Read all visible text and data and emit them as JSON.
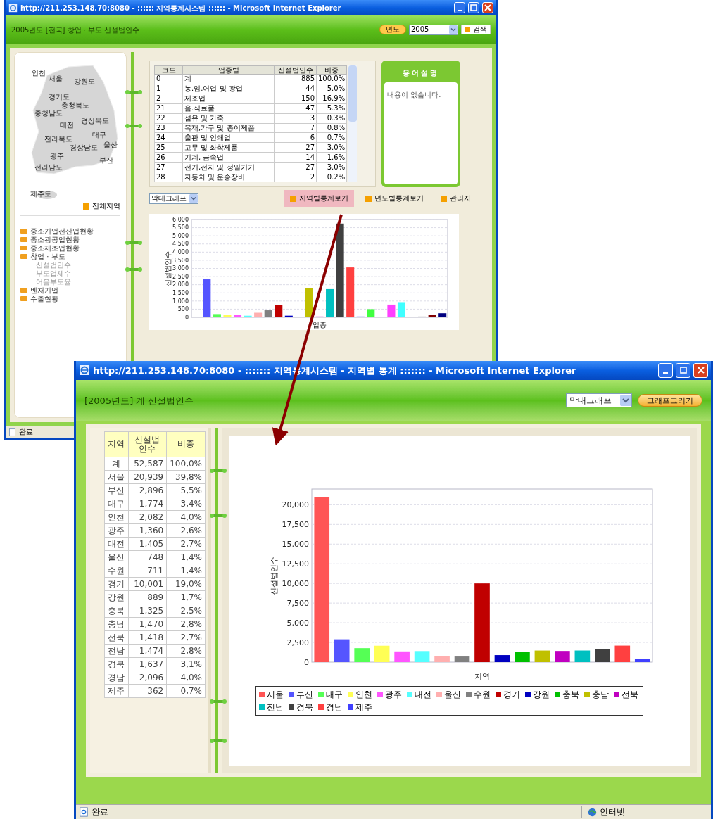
{
  "back_window": {
    "title": "http://211.253.148.70:8080 - :::::: 지역통계시스템 :::::: - Microsoft Internet Explorer",
    "header": "2005년도 [전국] 창업 · 부도 신설법인수",
    "year_button": "년도",
    "year_select": "2005",
    "search_button": "검색",
    "map_labels": [
      "인천",
      "서울",
      "강원도",
      "경기도",
      "충청북도",
      "충청남도",
      "경상북도",
      "대전",
      "대구",
      "전라북도",
      "경상남도",
      "울산",
      "광주",
      "부산",
      "전라남도",
      "제주도"
    ],
    "all_regions_button": "전체지역",
    "menu": [
      {
        "label": "중소기업전산업현황",
        "kind": "folder"
      },
      {
        "label": "중소광공업현황",
        "kind": "folder"
      },
      {
        "label": "중소제조업현황",
        "kind": "folder"
      },
      {
        "label": "창업 · 부도",
        "kind": "folder"
      },
      {
        "label": "신설법인수",
        "kind": "sub"
      },
      {
        "label": "부도업체수",
        "kind": "sub"
      },
      {
        "label": "어음부도율",
        "kind": "sub"
      },
      {
        "label": "벤처기업",
        "kind": "folder"
      },
      {
        "label": "수출현황",
        "kind": "folder"
      }
    ],
    "table": {
      "columns": [
        "코드",
        "업종별",
        "신설법인수",
        "비중"
      ],
      "rows": [
        [
          "0",
          "계",
          "885",
          "100.0%"
        ],
        [
          "1",
          "농.임.어업 및 광업",
          "44",
          "5.0%"
        ],
        [
          "2",
          "제조업",
          "150",
          "16.9%"
        ],
        [
          "21",
          "음.식료품",
          "47",
          "5.3%"
        ],
        [
          "22",
          "섬유 및 가죽",
          "3",
          "0.3%"
        ],
        [
          "23",
          "목재,가구 및 종이제품",
          "7",
          "0.8%"
        ],
        [
          "24",
          "출판 및 인쇄업",
          "6",
          "0.7%"
        ],
        [
          "25",
          "고무 및 화학제품",
          "27",
          "3.0%"
        ],
        [
          "26",
          "기계, 금속업",
          "14",
          "1.6%"
        ],
        [
          "27",
          "전기,전자 및 정밀기기",
          "27",
          "3.0%"
        ],
        [
          "28",
          "자동차 및 운송장비",
          "2",
          "0.2%"
        ]
      ]
    },
    "term_panel": {
      "title": "용어설명",
      "text": "내용이 없습니다."
    },
    "chart_type_select": "막대그래프",
    "actions": [
      {
        "label": "지역별통계보기",
        "highlighted": true
      },
      {
        "label": "년도별통계보기",
        "highlighted": false
      },
      {
        "label": "관리자",
        "highlighted": false
      }
    ],
    "chart": {
      "chart_data": {
        "type": "bar",
        "xlabel": "업종",
        "ylabel": "신설법인수",
        "grid": true,
        "values": [
          null,
          2330,
          200,
          150,
          130,
          100,
          280,
          430,
          750,
          100,
          null,
          1800,
          50,
          1730,
          5750,
          3060,
          50,
          500,
          null,
          780,
          930,
          null,
          50,
          130,
          250
        ],
        "ylim": [
          0,
          6000
        ],
        "yticks": [
          {
            "value": 0,
            "label": "0"
          },
          {
            "value": 500,
            "label": "500"
          },
          {
            "value": 1000,
            "label": "1,000"
          },
          {
            "value": 1500,
            "label": "1,500"
          },
          {
            "value": 2000,
            "label": "2,000"
          },
          {
            "value": 2500,
            "label": "2,500"
          },
          {
            "value": 3000,
            "label": "3,000"
          },
          {
            "value": 3500,
            "label": "3,500"
          },
          {
            "value": 4000,
            "label": "4,000"
          },
          {
            "value": 4500,
            "label": "4,500"
          },
          {
            "value": 5000,
            "label": "5,000"
          },
          {
            "value": 5500,
            "label": "5,500"
          },
          {
            "value": 6000,
            "label": "6,000"
          }
        ]
      },
      "bars": [
        {
          "color": "#5555ff"
        },
        {
          "color": "#55ff55"
        },
        {
          "color": "#ffff55"
        },
        {
          "color": "#ff55ff"
        },
        {
          "color": "#55ffff"
        },
        {
          "color": "#ffafaf"
        },
        {
          "color": "#808080"
        },
        {
          "color": "#c00000"
        },
        {
          "color": "#0000c0"
        },
        {
          "color": "#c0c000"
        },
        {
          "color": "#c000c0"
        },
        {
          "color": "#00c0c0"
        },
        {
          "color": "#404040"
        },
        {
          "color": "#ff4040"
        },
        {
          "color": "#4040ff"
        },
        {
          "color": "#40ff40"
        },
        {
          "color": "#ff40ff"
        },
        {
          "color": "#40ffff"
        },
        {
          "color": "#a0a0a0"
        },
        {
          "color": "#800000"
        },
        {
          "color": "#000080"
        }
      ]
    },
    "status_bar": "완료"
  },
  "front_window": {
    "title": "http://211.253.148.70:8080 - ::::::: 지역통계시스템 - 지역별 통계 ::::::: - Microsoft Internet Explorer",
    "header": "[2005년도] 계 신설법인수",
    "chart_type_select": "막대그래프",
    "draw_button": "그래프그리기",
    "table": {
      "columns": [
        "지역",
        "신설법인수",
        "비중"
      ],
      "rows": [
        [
          "계",
          "52,587",
          "100,0%"
        ],
        [
          "서울",
          "20,939",
          "39,8%"
        ],
        [
          "부산",
          "2,896",
          "5,5%"
        ],
        [
          "대구",
          "1,774",
          "3,4%"
        ],
        [
          "인천",
          "2,082",
          "4,0%"
        ],
        [
          "광주",
          "1,360",
          "2,6%"
        ],
        [
          "대전",
          "1,405",
          "2,7%"
        ],
        [
          "울산",
          "748",
          "1,4%"
        ],
        [
          "수원",
          "711",
          "1,4%"
        ],
        [
          "경기",
          "10,001",
          "19,0%"
        ],
        [
          "강원",
          "889",
          "1,7%"
        ],
        [
          "충북",
          "1,325",
          "2,5%"
        ],
        [
          "충남",
          "1,470",
          "2,8%"
        ],
        [
          "전북",
          "1,418",
          "2,7%"
        ],
        [
          "전남",
          "1,474",
          "2,8%"
        ],
        [
          "경북",
          "1,637",
          "3,1%"
        ],
        [
          "경남",
          "2,096",
          "4,0%"
        ],
        [
          "제주",
          "362",
          "0,7%"
        ]
      ]
    },
    "chart": {
      "chart_data": {
        "type": "bar",
        "xlabel": "지역",
        "ylabel": "신설법인수",
        "grid": true,
        "values": [
          20939,
          2896,
          1774,
          2082,
          1360,
          1405,
          748,
          711,
          10001,
          889,
          1325,
          1470,
          1418,
          1474,
          1637,
          2096,
          362
        ],
        "ylim": [
          0,
          22000
        ],
        "yticks": [
          {
            "value": 0,
            "label": "0"
          },
          {
            "value": 2500,
            "label": "2,500"
          },
          {
            "value": 5000,
            "label": "5,000"
          },
          {
            "value": 7500,
            "label": "7,500"
          },
          {
            "value": 10000,
            "label": "10,000"
          },
          {
            "value": 12500,
            "label": "12,500"
          },
          {
            "value": 15000,
            "label": "15,000"
          },
          {
            "value": 17500,
            "label": "17,500"
          },
          {
            "value": 20000,
            "label": "20,000"
          }
        ]
      },
      "legend": [
        {
          "label": "서울",
          "color": "#ff5555"
        },
        {
          "label": "부산",
          "color": "#5555ff"
        },
        {
          "label": "대구",
          "color": "#55ff55"
        },
        {
          "label": "인천",
          "color": "#ffff55"
        },
        {
          "label": "광주",
          "color": "#ff55ff"
        },
        {
          "label": "대전",
          "color": "#55ffff"
        },
        {
          "label": "울산",
          "color": "#ffafaf"
        },
        {
          "label": "수원",
          "color": "#808080"
        },
        {
          "label": "경기",
          "color": "#c00000"
        },
        {
          "label": "강원",
          "color": "#0000c0"
        },
        {
          "label": "충북",
          "color": "#00c000"
        },
        {
          "label": "충남",
          "color": "#c0c000"
        },
        {
          "label": "전북",
          "color": "#c000c0"
        },
        {
          "label": "전남",
          "color": "#00c0c0"
        },
        {
          "label": "경북",
          "color": "#404040"
        },
        {
          "label": "경남",
          "color": "#ff4040"
        },
        {
          "label": "제주",
          "color": "#4040ff"
        }
      ]
    },
    "status_bar": "완료",
    "zone": "인터넷"
  }
}
